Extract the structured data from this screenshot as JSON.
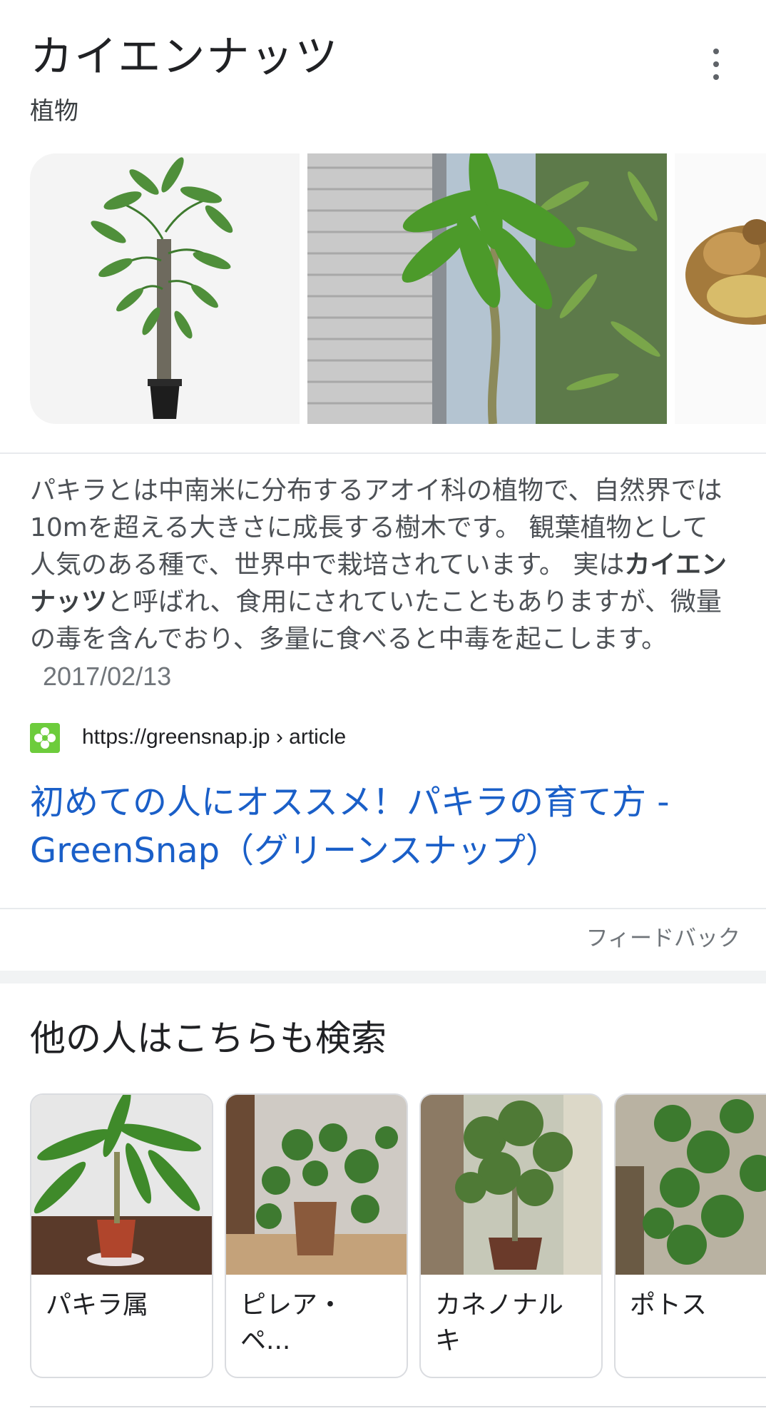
{
  "header": {
    "title": "カイエンナッツ",
    "subtitle": "植物",
    "more_icon": "more-vert-icon"
  },
  "images": [
    {
      "kind": "potted-tree-white-background"
    },
    {
      "kind": "plant-by-shutter"
    },
    {
      "kind": "seed-nut-partial"
    }
  ],
  "description": {
    "part1": "パキラとは中南米に分布するアオイ科の植物で、自然界では10mを超える大きさに成長する樹木です。 観葉植物として人気のある種で、世界中で栽培されています。 実は",
    "bold": "カイエンナッツ",
    "part2": "と呼ばれ、食用にされていたこともありますが、微量の毒を含んでおり、多量に食べると中毒を起こします。",
    "date": "2017/02/13"
  },
  "source": {
    "favicon_color": "#6dcc3c",
    "url": "https://greensnap.jp › article",
    "link_title": "初めての人にオススメ！パキラの育て方 - GreenSnap（グリーンスナップ）",
    "link_color": "#1a5fc8"
  },
  "feedback_label": "フィードバック",
  "related": {
    "title": "他の人はこちらも検索",
    "items": [
      {
        "label": "パキラ属"
      },
      {
        "label": "ピレア・ペ..."
      },
      {
        "label": "カネノナルキ"
      },
      {
        "label": "ポトス"
      }
    ]
  }
}
